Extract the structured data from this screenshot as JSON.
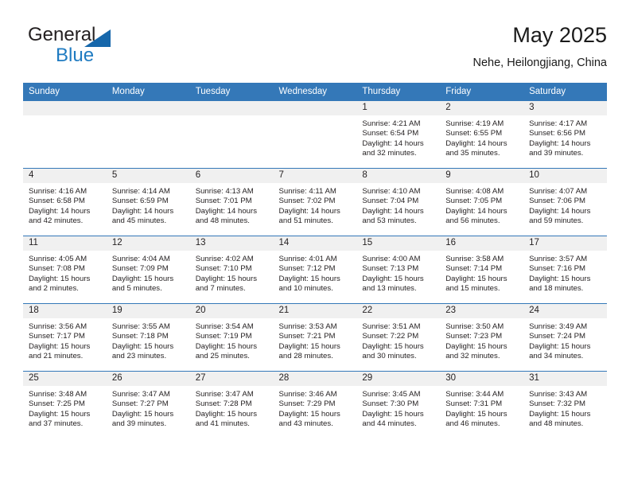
{
  "logo": {
    "word1": "General",
    "word2": "Blue",
    "triangle_color": "#1667ab",
    "blue_color": "#1f7bc1"
  },
  "header": {
    "title": "May 2025",
    "subtitle": "Nehe, Heilongjiang, China"
  },
  "theme": {
    "header_blue": "#3478b8",
    "daynum_bg": "#f0f0f0",
    "text": "#231f20"
  },
  "weekdays": [
    "Sunday",
    "Monday",
    "Tuesday",
    "Wednesday",
    "Thursday",
    "Friday",
    "Saturday"
  ],
  "labels": {
    "sunrise": "Sunrise:",
    "sunset": "Sunset:",
    "daylight": "Daylight:"
  },
  "weeks": [
    [
      {
        "day": ""
      },
      {
        "day": ""
      },
      {
        "day": ""
      },
      {
        "day": ""
      },
      {
        "day": "1",
        "sunrise": "Sunrise: 4:21 AM",
        "sunset": "Sunset: 6:54 PM",
        "daylight": "Daylight: 14 hours and 32 minutes."
      },
      {
        "day": "2",
        "sunrise": "Sunrise: 4:19 AM",
        "sunset": "Sunset: 6:55 PM",
        "daylight": "Daylight: 14 hours and 35 minutes."
      },
      {
        "day": "3",
        "sunrise": "Sunrise: 4:17 AM",
        "sunset": "Sunset: 6:56 PM",
        "daylight": "Daylight: 14 hours and 39 minutes."
      }
    ],
    [
      {
        "day": "4",
        "sunrise": "Sunrise: 4:16 AM",
        "sunset": "Sunset: 6:58 PM",
        "daylight": "Daylight: 14 hours and 42 minutes."
      },
      {
        "day": "5",
        "sunrise": "Sunrise: 4:14 AM",
        "sunset": "Sunset: 6:59 PM",
        "daylight": "Daylight: 14 hours and 45 minutes."
      },
      {
        "day": "6",
        "sunrise": "Sunrise: 4:13 AM",
        "sunset": "Sunset: 7:01 PM",
        "daylight": "Daylight: 14 hours and 48 minutes."
      },
      {
        "day": "7",
        "sunrise": "Sunrise: 4:11 AM",
        "sunset": "Sunset: 7:02 PM",
        "daylight": "Daylight: 14 hours and 51 minutes."
      },
      {
        "day": "8",
        "sunrise": "Sunrise: 4:10 AM",
        "sunset": "Sunset: 7:04 PM",
        "daylight": "Daylight: 14 hours and 53 minutes."
      },
      {
        "day": "9",
        "sunrise": "Sunrise: 4:08 AM",
        "sunset": "Sunset: 7:05 PM",
        "daylight": "Daylight: 14 hours and 56 minutes."
      },
      {
        "day": "10",
        "sunrise": "Sunrise: 4:07 AM",
        "sunset": "Sunset: 7:06 PM",
        "daylight": "Daylight: 14 hours and 59 minutes."
      }
    ],
    [
      {
        "day": "11",
        "sunrise": "Sunrise: 4:05 AM",
        "sunset": "Sunset: 7:08 PM",
        "daylight": "Daylight: 15 hours and 2 minutes."
      },
      {
        "day": "12",
        "sunrise": "Sunrise: 4:04 AM",
        "sunset": "Sunset: 7:09 PM",
        "daylight": "Daylight: 15 hours and 5 minutes."
      },
      {
        "day": "13",
        "sunrise": "Sunrise: 4:02 AM",
        "sunset": "Sunset: 7:10 PM",
        "daylight": "Daylight: 15 hours and 7 minutes."
      },
      {
        "day": "14",
        "sunrise": "Sunrise: 4:01 AM",
        "sunset": "Sunset: 7:12 PM",
        "daylight": "Daylight: 15 hours and 10 minutes."
      },
      {
        "day": "15",
        "sunrise": "Sunrise: 4:00 AM",
        "sunset": "Sunset: 7:13 PM",
        "daylight": "Daylight: 15 hours and 13 minutes."
      },
      {
        "day": "16",
        "sunrise": "Sunrise: 3:58 AM",
        "sunset": "Sunset: 7:14 PM",
        "daylight": "Daylight: 15 hours and 15 minutes."
      },
      {
        "day": "17",
        "sunrise": "Sunrise: 3:57 AM",
        "sunset": "Sunset: 7:16 PM",
        "daylight": "Daylight: 15 hours and 18 minutes."
      }
    ],
    [
      {
        "day": "18",
        "sunrise": "Sunrise: 3:56 AM",
        "sunset": "Sunset: 7:17 PM",
        "daylight": "Daylight: 15 hours and 21 minutes."
      },
      {
        "day": "19",
        "sunrise": "Sunrise: 3:55 AM",
        "sunset": "Sunset: 7:18 PM",
        "daylight": "Daylight: 15 hours and 23 minutes."
      },
      {
        "day": "20",
        "sunrise": "Sunrise: 3:54 AM",
        "sunset": "Sunset: 7:19 PM",
        "daylight": "Daylight: 15 hours and 25 minutes."
      },
      {
        "day": "21",
        "sunrise": "Sunrise: 3:53 AM",
        "sunset": "Sunset: 7:21 PM",
        "daylight": "Daylight: 15 hours and 28 minutes."
      },
      {
        "day": "22",
        "sunrise": "Sunrise: 3:51 AM",
        "sunset": "Sunset: 7:22 PM",
        "daylight": "Daylight: 15 hours and 30 minutes."
      },
      {
        "day": "23",
        "sunrise": "Sunrise: 3:50 AM",
        "sunset": "Sunset: 7:23 PM",
        "daylight": "Daylight: 15 hours and 32 minutes."
      },
      {
        "day": "24",
        "sunrise": "Sunrise: 3:49 AM",
        "sunset": "Sunset: 7:24 PM",
        "daylight": "Daylight: 15 hours and 34 minutes."
      }
    ],
    [
      {
        "day": "25",
        "sunrise": "Sunrise: 3:48 AM",
        "sunset": "Sunset: 7:25 PM",
        "daylight": "Daylight: 15 hours and 37 minutes."
      },
      {
        "day": "26",
        "sunrise": "Sunrise: 3:47 AM",
        "sunset": "Sunset: 7:27 PM",
        "daylight": "Daylight: 15 hours and 39 minutes."
      },
      {
        "day": "27",
        "sunrise": "Sunrise: 3:47 AM",
        "sunset": "Sunset: 7:28 PM",
        "daylight": "Daylight: 15 hours and 41 minutes."
      },
      {
        "day": "28",
        "sunrise": "Sunrise: 3:46 AM",
        "sunset": "Sunset: 7:29 PM",
        "daylight": "Daylight: 15 hours and 43 minutes."
      },
      {
        "day": "29",
        "sunrise": "Sunrise: 3:45 AM",
        "sunset": "Sunset: 7:30 PM",
        "daylight": "Daylight: 15 hours and 44 minutes."
      },
      {
        "day": "30",
        "sunrise": "Sunrise: 3:44 AM",
        "sunset": "Sunset: 7:31 PM",
        "daylight": "Daylight: 15 hours and 46 minutes."
      },
      {
        "day": "31",
        "sunrise": "Sunrise: 3:43 AM",
        "sunset": "Sunset: 7:32 PM",
        "daylight": "Daylight: 15 hours and 48 minutes."
      }
    ]
  ]
}
